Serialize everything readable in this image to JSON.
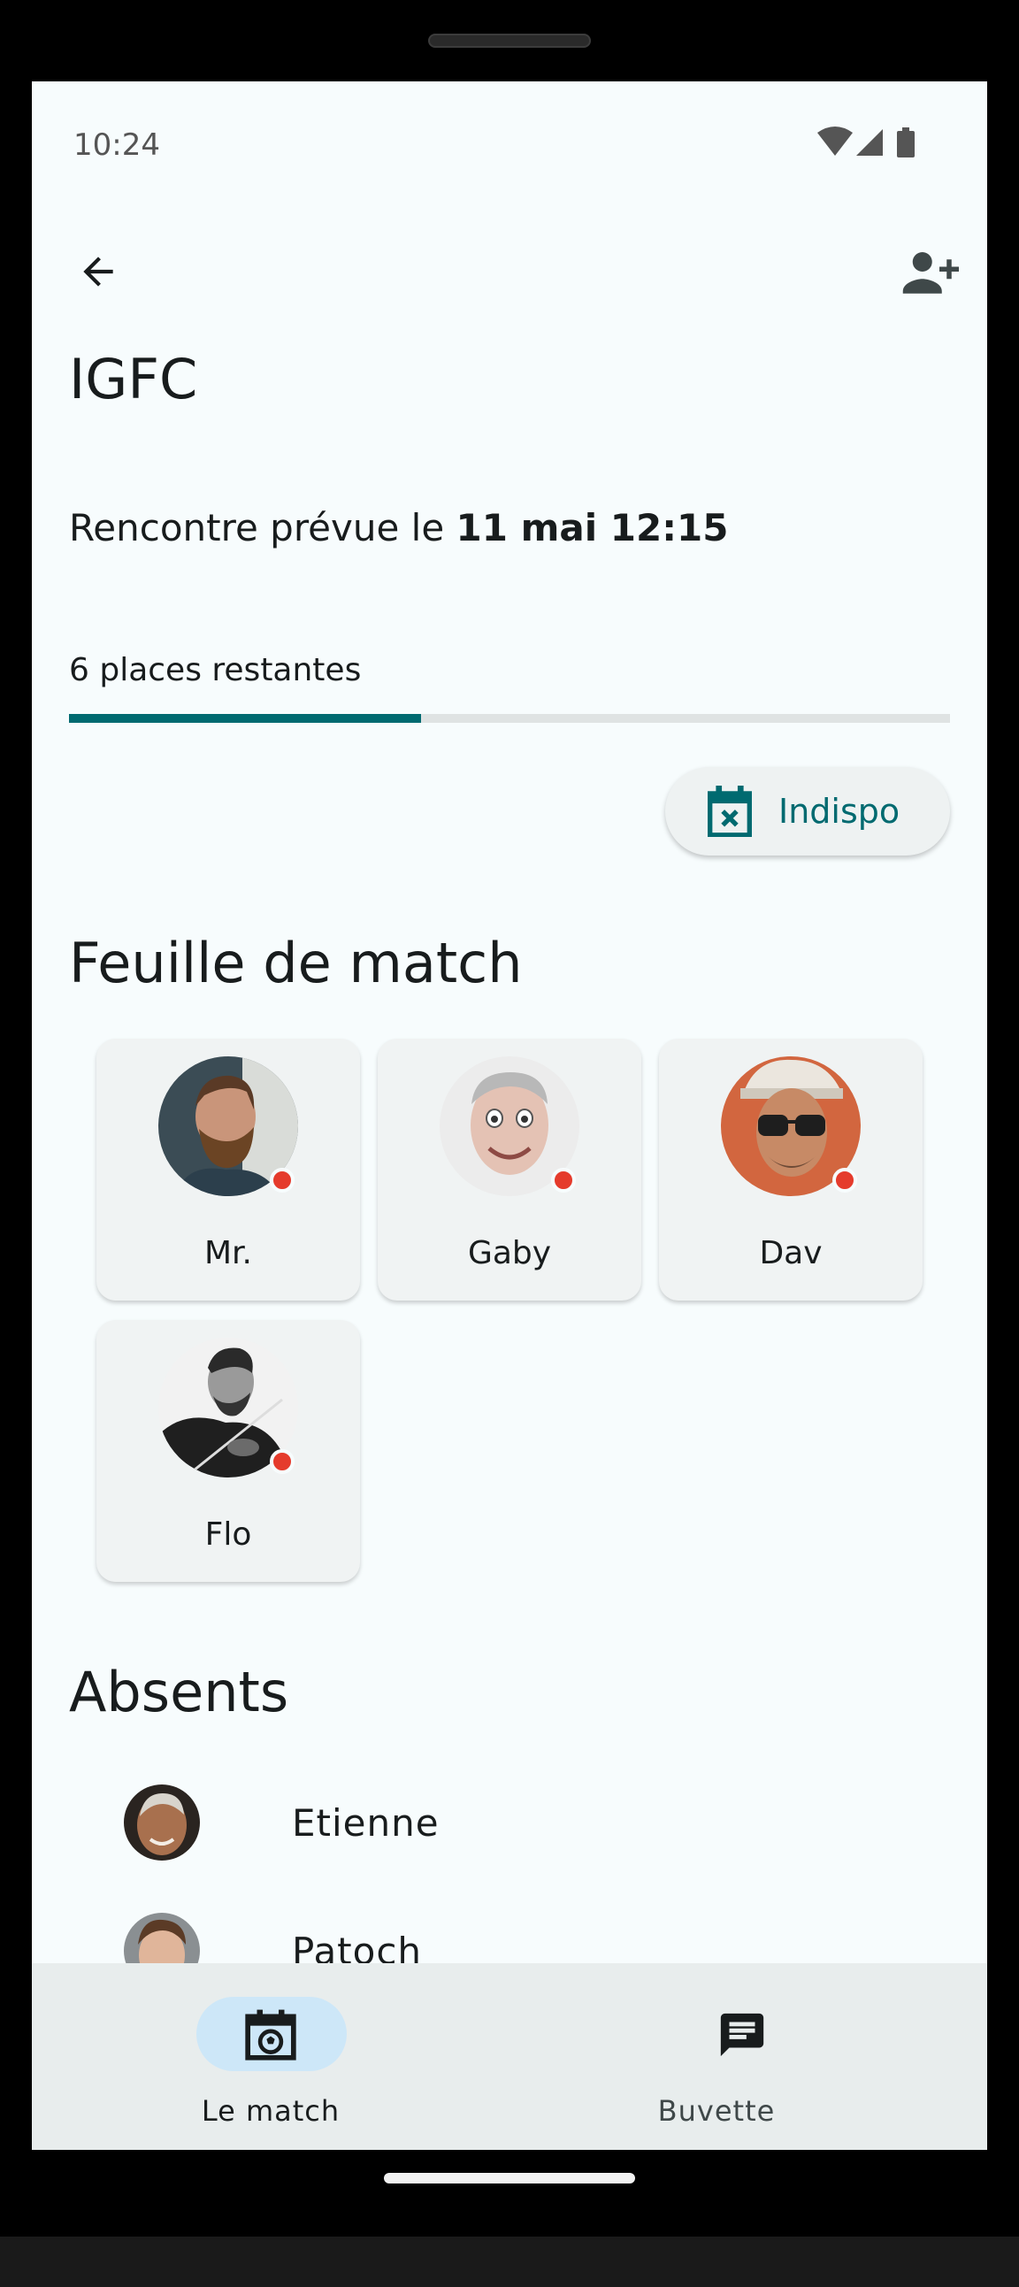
{
  "status_bar": {
    "time": "10:24"
  },
  "header": {
    "title": "IGFC"
  },
  "schedule": {
    "prefix": "Rencontre prévue le ",
    "datetime": "11 mai 12:15"
  },
  "availability": {
    "places_label": "6 places restantes",
    "fill_fraction": 0.4
  },
  "unavailable_button": {
    "label": "Indispo",
    "icon": "calendar-x-icon"
  },
  "lineup": {
    "title": "Feuille de match",
    "players": [
      {
        "name": "Mr.",
        "status_color": "#e53b2c"
      },
      {
        "name": "Gaby",
        "status_color": "#e53b2c"
      },
      {
        "name": "Dav",
        "status_color": "#e53b2c"
      },
      {
        "name": "Flo",
        "status_color": "#e53b2c"
      }
    ]
  },
  "absents": {
    "title": "Absents",
    "players": [
      {
        "name": "Etienne"
      },
      {
        "name": "Patoch"
      }
    ]
  },
  "bottom_nav": {
    "items": [
      {
        "label": "Le match",
        "icon": "calendar-ball-icon",
        "active": true
      },
      {
        "label": "Buvette",
        "icon": "chat-icon",
        "active": false
      }
    ]
  },
  "colors": {
    "accent": "#006a70",
    "status_dot": "#e53b2c",
    "active_pill": "#cde7f8"
  }
}
